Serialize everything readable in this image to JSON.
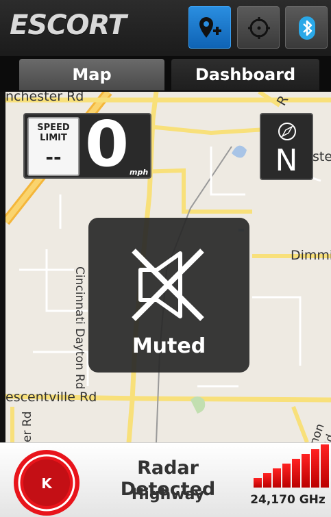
{
  "header": {
    "logo": "ESCORT",
    "buttons": [
      {
        "icon": "add-location-icon",
        "active": true
      },
      {
        "icon": "crosshair-icon",
        "active": false
      },
      {
        "icon": "bluetooth-icon",
        "active": false
      }
    ]
  },
  "tabs": [
    {
      "label": "Map",
      "selected": true
    },
    {
      "label": "Dashboard",
      "selected": false
    }
  ],
  "map": {
    "labels": {
      "top_left_road": "nchester Rd",
      "top_right_road": "R",
      "right_road": "ste",
      "dimmick": "Dimmic",
      "cincinnati": "Cincinnati Dayton Rd",
      "crescentville": "escentville Rd",
      "bottom_left": "er Rd",
      "bottom_right": "non Rd"
    }
  },
  "speed": {
    "limit_label": "SPEED LIMIT",
    "limit_value": "--",
    "current": "0",
    "unit": "mph"
  },
  "compass": {
    "direction": "N"
  },
  "muted": {
    "label": "Muted"
  },
  "alert": {
    "band": "K",
    "title": "Radar Detected",
    "subtitle": "Highway",
    "frequency": "24,170 GHz",
    "signal_bars": 8,
    "accent": "#e8141b"
  }
}
